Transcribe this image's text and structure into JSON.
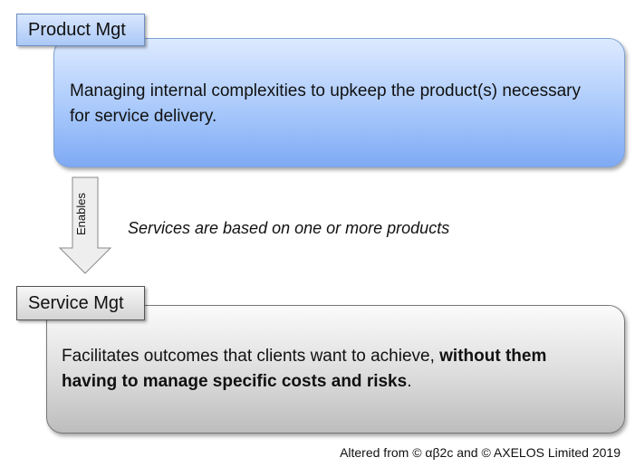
{
  "product": {
    "tab_label": "Product Mgt",
    "description": "Managing internal complexities to upkeep the product(s) necessary for service delivery."
  },
  "connector": {
    "arrow_label": "Enables",
    "note": "Services are based on one or more products"
  },
  "service": {
    "tab_label": "Service Mgt",
    "description_plain": "Facilitates outcomes that clients want to achieve, ",
    "description_bold": "without them having to manage specific costs and risks",
    "description_end": "."
  },
  "credit": "Altered from © αβ2c and © AXELOS Limited 2019",
  "colors": {
    "product_fill": "#a9c9fb",
    "service_fill": "#dcdcdc"
  }
}
